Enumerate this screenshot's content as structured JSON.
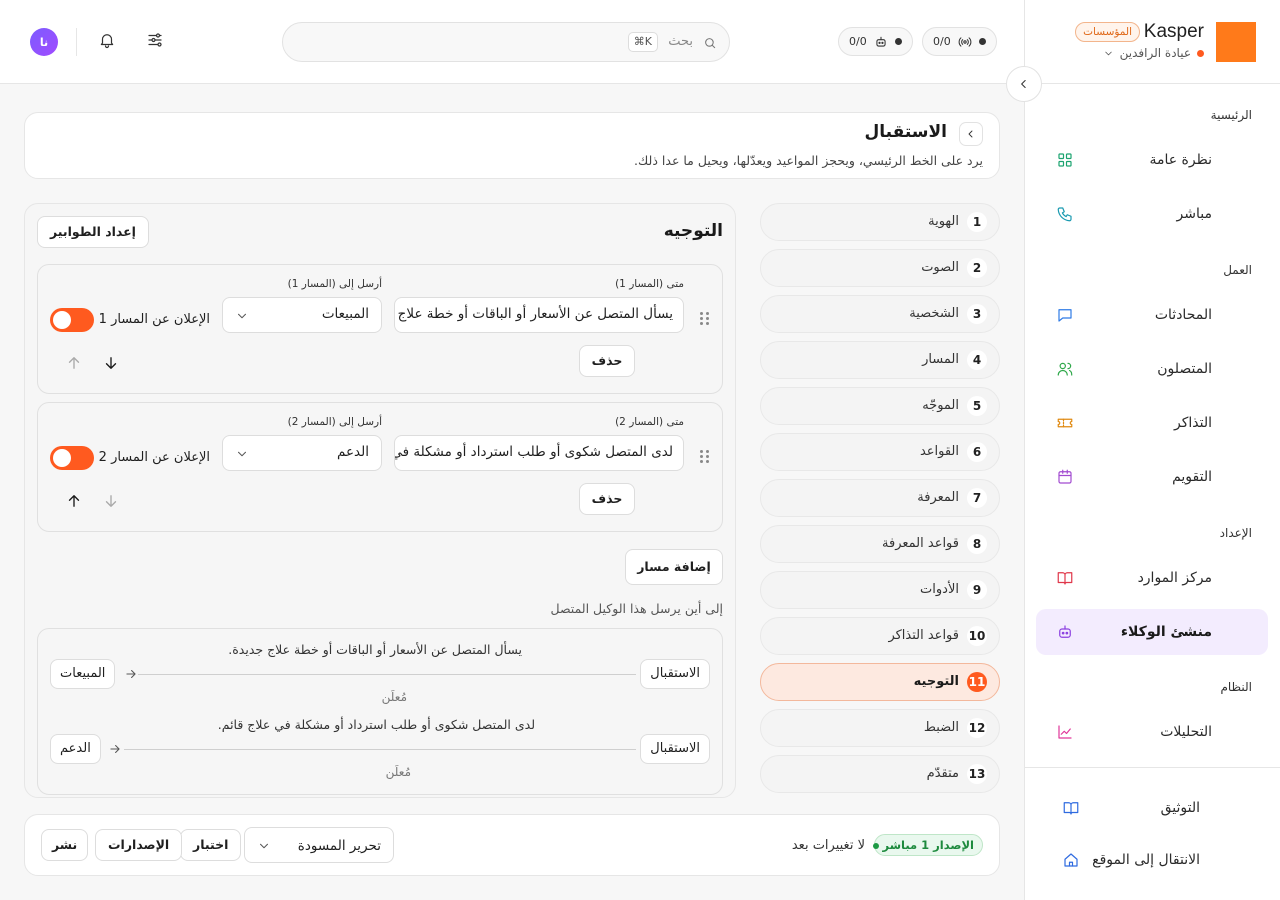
{
  "brand": {
    "name": "Kasper",
    "badge": "المؤسسات",
    "org": "عيادة الرافدين"
  },
  "topbar": {
    "stat_calls": "0/0",
    "stat_bots": "0/0",
    "search_placeholder": "بحث",
    "search_shortcut": "⌘K",
    "avatar_initials": "نا"
  },
  "sidebar": {
    "sections": {
      "main": "الرئيسية",
      "work": "العمل",
      "setup": "الإعداد",
      "system": "النظام"
    },
    "items": {
      "overview": "نظرة عامة",
      "live": "مباشر",
      "conversations": "المحادثات",
      "callers": "المتصلون",
      "tickets": "التذاكر",
      "calendar": "التقويم",
      "resources": "مركز الموارد",
      "agent_builder": "منشئ الوكلاء",
      "analytics": "التحليلات",
      "docs": "التوثيق",
      "go_site": "الانتقال إلى الموقع"
    }
  },
  "header": {
    "title": "الاستقبال",
    "subtitle": "يرد على الخط الرئيسي، ويحجز المواعيد ويعدّلها، ويحيل ما عدا ذلك."
  },
  "steps": [
    {
      "num": "1",
      "label": "الهوية"
    },
    {
      "num": "2",
      "label": "الصوت"
    },
    {
      "num": "3",
      "label": "الشخصية"
    },
    {
      "num": "4",
      "label": "المسار"
    },
    {
      "num": "5",
      "label": "الموجّه"
    },
    {
      "num": "6",
      "label": "القواعد"
    },
    {
      "num": "7",
      "label": "المعرفة"
    },
    {
      "num": "8",
      "label": "قواعد المعرفة"
    },
    {
      "num": "9",
      "label": "الأدوات"
    },
    {
      "num": "10",
      "label": "قواعد التذاكر"
    },
    {
      "num": "11",
      "label": "التوجيه"
    },
    {
      "num": "12",
      "label": "الضبط"
    },
    {
      "num": "13",
      "label": "متقدّم"
    }
  ],
  "routing": {
    "title": "التوجيه",
    "queues_button": "إعداد الطوابير",
    "routes": [
      {
        "when_label": "متى (المسار 1)",
        "when_value": "يسأل المتصل عن الأسعار أو الباقات أو خطة علاج جديدة.",
        "send_label": "أرسل إلى (المسار 1)",
        "send_value": "المبيعات",
        "announce_label": "الإعلان عن المسار 1",
        "delete_label": "حذف"
      },
      {
        "when_label": "متى (المسار 2)",
        "when_value": "لدى المتصل شكوى أو طلب استرداد أو مشكلة في علاج قائم.",
        "send_label": "أرسل إلى (المسار 2)",
        "send_value": "الدعم",
        "announce_label": "الإعلان عن المسار 2",
        "delete_label": "حذف"
      }
    ],
    "add_route": "إضافة مسار",
    "caption": "إلى أين يرسل هذا الوكيل المتصل",
    "summary": [
      {
        "from": "الاستقبال",
        "desc": "يسأل المتصل عن الأسعار أو الباقات أو خطة علاج جديدة.",
        "to": "المبيعات",
        "status": "مُعلَن"
      },
      {
        "from": "الاستقبال",
        "desc": "لدى المتصل شكوى أو طلب استرداد أو مشكلة في علاج قائم.",
        "to": "الدعم",
        "status": "مُعلَن"
      }
    ]
  },
  "footer": {
    "version_badge": "الإصدار 1 مباشر",
    "status": "لا تغييرات بعد",
    "draft_select": "تحرير المسودة",
    "test_button": "اختبار",
    "versions_button": "الإصدارات",
    "publish_button": "نشر"
  },
  "colors": {
    "accent": "#ff5a1f",
    "brand_logo": "#ff7a1a",
    "active_nav_bg": "#f3ecfe",
    "live_green": "#1d9a44"
  }
}
